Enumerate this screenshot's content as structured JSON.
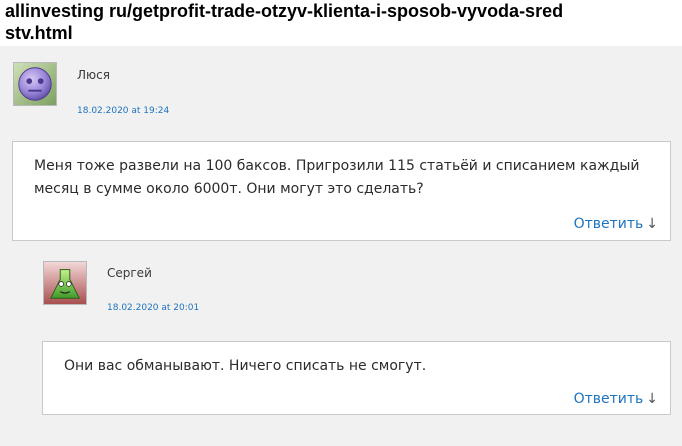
{
  "page": {
    "url_text": "allinvesting ru/getprofit-trade-otzyv-klienta-i-sposob-vyvoda-sredstv.html"
  },
  "colors": {
    "link": "#1e73be",
    "background": "#f1f1f1",
    "box_border": "#c9c9c9"
  },
  "comments": [
    {
      "author": "Люся",
      "date": "18.02.2020 at 19:24",
      "text": "Меня тоже развели на 100 баксов. Пригрозили 115 статьёй и списанием каждый месяц в сумме около 6000т. Они могут это сделать?",
      "reply_label": "Ответить",
      "reply_icon": "arrow-down-icon",
      "avatar_icon": "purple-smiley-avatar"
    },
    {
      "author": "Сергей",
      "date": "18.02.2020 at 20:01",
      "text": "Они вас обманывают. Ничего списать не смогут.",
      "reply_label": "Ответить",
      "reply_icon": "arrow-down-icon",
      "avatar_icon": "green-flask-avatar"
    }
  ]
}
